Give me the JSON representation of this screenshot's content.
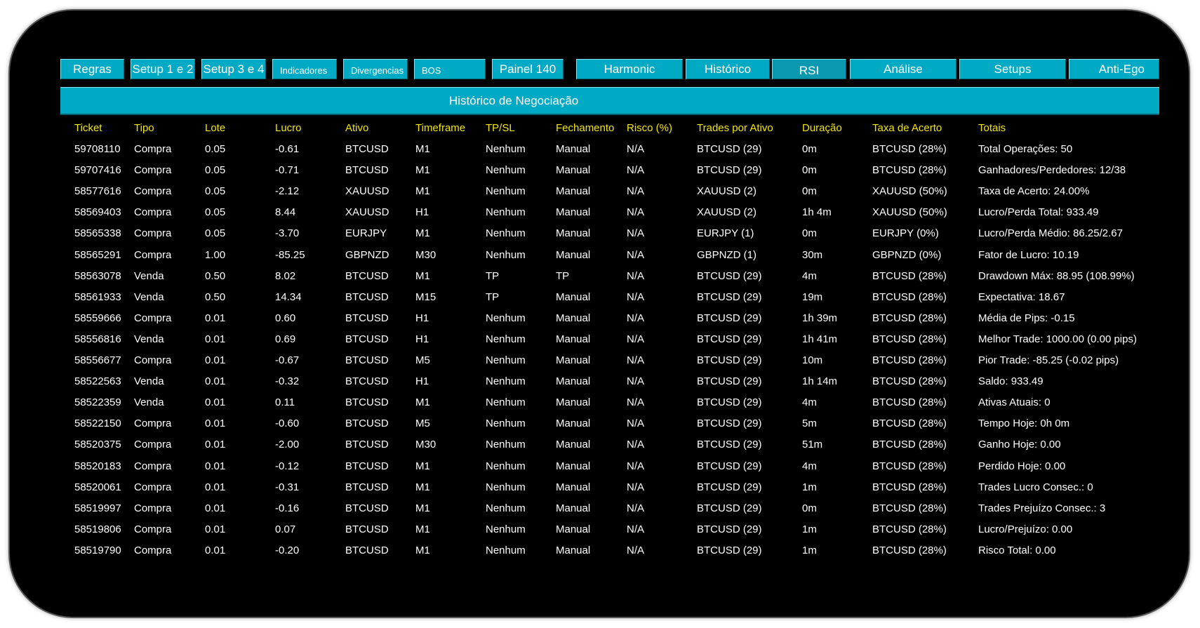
{
  "tabs": [
    {
      "label": "Regras"
    },
    {
      "label": "Setup 1 e 2"
    },
    {
      "label": "Setup 3 e 4"
    },
    {
      "label": "Indicadores"
    },
    {
      "label": "Divergencias"
    },
    {
      "label": "BOS"
    },
    {
      "label": "Painel 140"
    },
    {
      "label": "Harmonic"
    },
    {
      "label": "Histórico"
    },
    {
      "label": "RSI"
    },
    {
      "label": "Análise"
    },
    {
      "label": "Setups"
    },
    {
      "label": "Anti-Ego"
    }
  ],
  "section_title": "Histórico de Negociação",
  "colors": {
    "accent": "#00a9c4",
    "header_text": "#f2e600",
    "background": "#000000",
    "text": "#ffffff"
  },
  "table": {
    "columns": [
      "Ticket",
      "Tipo",
      "Lote",
      "Lucro",
      "Ativo",
      "Timeframe",
      "TP/SL",
      "Fechamento",
      "Risco (%)",
      "Trades por Ativo",
      "Duração",
      "Taxa de Acerto",
      "Totais"
    ],
    "rows": [
      [
        "59708110",
        "Compra",
        "0.05",
        "-0.61",
        "BTCUSD",
        "M1",
        "Nenhum",
        "Manual",
        "N/A",
        "BTCUSD (29)",
        "0m",
        "BTCUSD (28%)",
        "Total Operações: 50"
      ],
      [
        "59707416",
        "Compra",
        "0.05",
        "-0.71",
        "BTCUSD",
        "M1",
        "Nenhum",
        "Manual",
        "N/A",
        "BTCUSD (29)",
        "0m",
        "BTCUSD (28%)",
        "Ganhadores/Perdedores: 12/38"
      ],
      [
        "58577616",
        "Compra",
        "0.05",
        "-2.12",
        "XAUUSD",
        "M1",
        "Nenhum",
        "Manual",
        "N/A",
        "XAUUSD (2)",
        "0m",
        "XAUUSD (50%)",
        "Taxa de Acerto: 24.00%"
      ],
      [
        "58569403",
        "Compra",
        "0.05",
        "8.44",
        "XAUUSD",
        "H1",
        "Nenhum",
        "Manual",
        "N/A",
        "XAUUSD (2)",
        "1h 4m",
        "XAUUSD (50%)",
        "Lucro/Perda Total: 933.49"
      ],
      [
        "58565338",
        "Compra",
        "0.05",
        "-3.70",
        "EURJPY",
        "M1",
        "Nenhum",
        "Manual",
        "N/A",
        "EURJPY (1)",
        "0m",
        "EURJPY (0%)",
        "Lucro/Perda Médio: 86.25/2.67"
      ],
      [
        "58565291",
        "Compra",
        "1.00",
        "-85.25",
        "GBPNZD",
        "M30",
        "Nenhum",
        "Manual",
        "N/A",
        "GBPNZD (1)",
        "30m",
        "GBPNZD (0%)",
        "Fator de Lucro: 10.19"
      ],
      [
        "58563078",
        "Venda",
        "0.50",
        "8.02",
        "BTCUSD",
        "M1",
        "TP",
        "TP",
        "N/A",
        "BTCUSD (29)",
        "4m",
        "BTCUSD (28%)",
        "Drawdown Máx: 88.95 (108.99%)"
      ],
      [
        "58561933",
        "Venda",
        "0.50",
        "14.34",
        "BTCUSD",
        "M15",
        "TP",
        "Manual",
        "N/A",
        "BTCUSD (29)",
        "19m",
        "BTCUSD (28%)",
        "Expectativa: 18.67"
      ],
      [
        "58559666",
        "Compra",
        "0.01",
        "0.60",
        "BTCUSD",
        "H1",
        "Nenhum",
        "Manual",
        "N/A",
        "BTCUSD (29)",
        "1h 39m",
        "BTCUSD (28%)",
        "Média de Pips: -0.15"
      ],
      [
        "58556816",
        "Venda",
        "0.01",
        "0.69",
        "BTCUSD",
        "H1",
        "Nenhum",
        "Manual",
        "N/A",
        "BTCUSD (29)",
        "1h 41m",
        "BTCUSD (28%)",
        "Melhor Trade: 1000.00 (0.00 pips)"
      ],
      [
        "58556677",
        "Compra",
        "0.01",
        "-0.67",
        "BTCUSD",
        "M5",
        "Nenhum",
        "Manual",
        "N/A",
        "BTCUSD (29)",
        "10m",
        "BTCUSD (28%)",
        "Pior Trade: -85.25 (-0.02 pips)"
      ],
      [
        "58522563",
        "Venda",
        "0.01",
        "-0.32",
        "BTCUSD",
        "H1",
        "Nenhum",
        "Manual",
        "N/A",
        "BTCUSD (29)",
        "1h 14m",
        "BTCUSD (28%)",
        "Saldo: 933.49"
      ],
      [
        "58522359",
        "Venda",
        "0.01",
        "0.11",
        "BTCUSD",
        "M1",
        "Nenhum",
        "Manual",
        "N/A",
        "BTCUSD (29)",
        "4m",
        "BTCUSD (28%)",
        "Ativas Atuais: 0"
      ],
      [
        "58522150",
        "Compra",
        "0.01",
        "-0.60",
        "BTCUSD",
        "M5",
        "Nenhum",
        "Manual",
        "N/A",
        "BTCUSD (29)",
        "5m",
        "BTCUSD (28%)",
        "Tempo Hoje: 0h 0m"
      ],
      [
        "58520375",
        "Compra",
        "0.01",
        "-2.00",
        "BTCUSD",
        "M30",
        "Nenhum",
        "Manual",
        "N/A",
        "BTCUSD (29)",
        "51m",
        "BTCUSD (28%)",
        "Ganho Hoje: 0.00"
      ],
      [
        "58520183",
        "Compra",
        "0.01",
        "-0.12",
        "BTCUSD",
        "M1",
        "Nenhum",
        "Manual",
        "N/A",
        "BTCUSD (29)",
        "4m",
        "BTCUSD (28%)",
        "Perdido Hoje: 0.00"
      ],
      [
        "58520061",
        "Compra",
        "0.01",
        "-0.31",
        "BTCUSD",
        "M1",
        "Nenhum",
        "Manual",
        "N/A",
        "BTCUSD (29)",
        "1m",
        "BTCUSD (28%)",
        "Trades Lucro Consec.: 0"
      ],
      [
        "58519997",
        "Compra",
        "0.01",
        "-0.16",
        "BTCUSD",
        "M1",
        "Nenhum",
        "Manual",
        "N/A",
        "BTCUSD (29)",
        "0m",
        "BTCUSD (28%)",
        "Trades Prejuízo Consec.: 3"
      ],
      [
        "58519806",
        "Compra",
        "0.01",
        "0.07",
        "BTCUSD",
        "M1",
        "Nenhum",
        "Manual",
        "N/A",
        "BTCUSD (29)",
        "1m",
        "BTCUSD (28%)",
        "Lucro/Prejuízo: 0.00"
      ],
      [
        "58519790",
        "Compra",
        "0.01",
        "-0.20",
        "BTCUSD",
        "M1",
        "Nenhum",
        "Manual",
        "N/A",
        "BTCUSD (29)",
        "1m",
        "BTCUSD (28%)",
        "Risco Total: 0.00"
      ]
    ]
  }
}
